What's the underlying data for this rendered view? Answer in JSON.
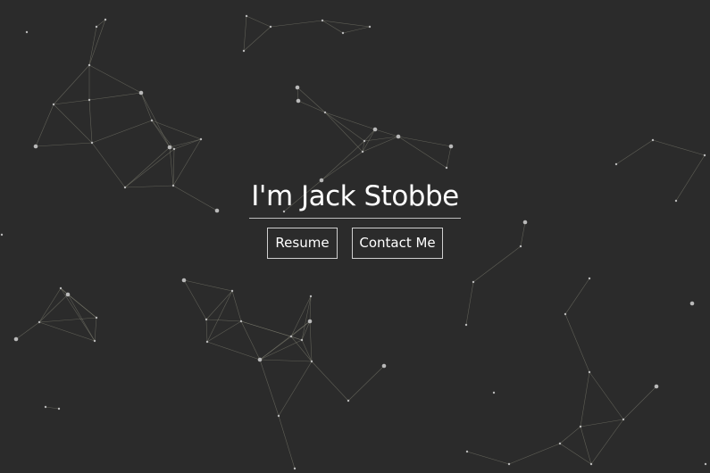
{
  "hero": {
    "title": "I'm Jack Stobbe",
    "buttons": {
      "resume_label": "Resume",
      "contact_label": "Contact Me"
    }
  },
  "colors": {
    "background": "#2b2b2b",
    "text": "#ffffff",
    "node": "#b9b9b9",
    "link": "#8a8a7a"
  }
}
